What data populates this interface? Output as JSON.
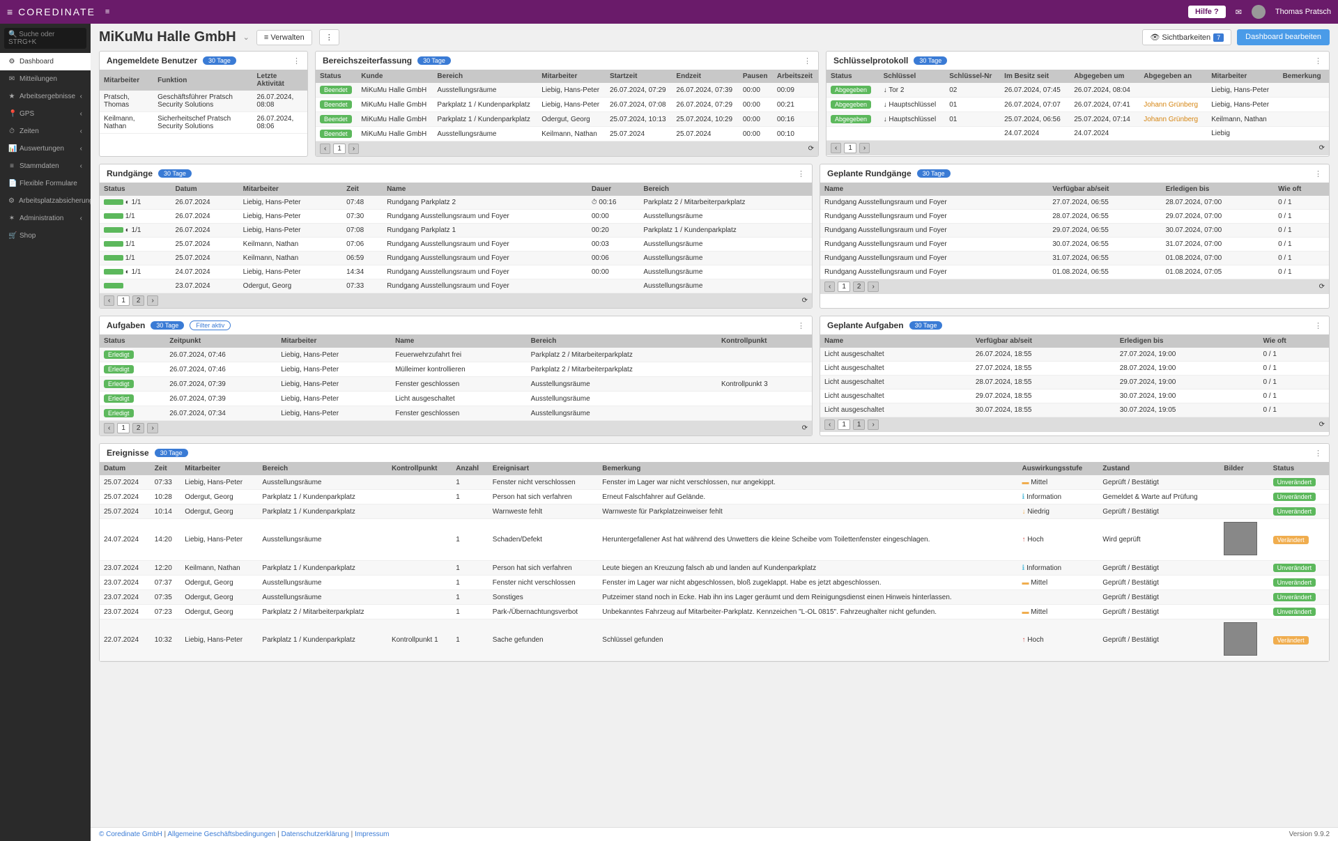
{
  "app": {
    "logo": "COREDINATE",
    "hilfe": "Hilfe",
    "user": "Thomas Pratsch"
  },
  "search": {
    "placeholder": "Suche oder STRG+K"
  },
  "nav": [
    {
      "icon": "⚙",
      "label": "Dashboard",
      "active": true
    },
    {
      "icon": "✉",
      "label": "Mitteilungen"
    },
    {
      "icon": "★",
      "label": "Arbeitsergebnisse",
      "chev": true
    },
    {
      "icon": "📍",
      "label": "GPS",
      "chev": true
    },
    {
      "icon": "⏱",
      "label": "Zeiten",
      "chev": true
    },
    {
      "icon": "📊",
      "label": "Auswertungen",
      "chev": true
    },
    {
      "icon": "≡",
      "label": "Stammdaten",
      "chev": true
    },
    {
      "icon": "📄",
      "label": "Flexible Formulare"
    },
    {
      "icon": "⚙",
      "label": "Arbeitsplatzabsicherung",
      "chev": true
    },
    {
      "icon": "✶",
      "label": "Administration",
      "chev": true
    },
    {
      "icon": "🛒",
      "label": "Shop"
    }
  ],
  "page": {
    "title": "MiKuMu Halle GmbH",
    "verwalten": "Verwalten",
    "sichtbarkeiten": "Sichtbarkeiten",
    "sb_count": "7",
    "dashboard_btn": "Dashboard bearbeiten"
  },
  "panels": {
    "benutzer": {
      "title": "Angemeldete Benutzer",
      "tag": "30 Tage",
      "cols": [
        "Mitarbeiter",
        "Funktion",
        "Letzte Aktivität"
      ],
      "rows": [
        [
          "Pratsch, Thomas",
          "Geschäftsführer Pratsch Security Solutions",
          "26.07.2024, 08:08"
        ],
        [
          "Keilmann, Nathan",
          "Sicherheitschef Pratsch Security Solutions",
          "26.07.2024, 08:06"
        ]
      ]
    },
    "bereich": {
      "title": "Bereichszeiterfassung",
      "tag": "30 Tage",
      "cols": [
        "Status",
        "Kunde",
        "Bereich",
        "Mitarbeiter",
        "Startzeit",
        "Endzeit",
        "Pausen",
        "Arbeitszeit"
      ],
      "rows": [
        [
          "Beendet",
          "MiKuMu Halle GmbH",
          "Ausstellungsräume",
          "Liebig, Hans-Peter",
          "26.07.2024, 07:29",
          "26.07.2024, 07:39",
          "00:00",
          "00:09"
        ],
        [
          "Beendet",
          "MiKuMu Halle GmbH",
          "Parkplatz 1 / Kundenparkplatz",
          "Liebig, Hans-Peter",
          "26.07.2024, 07:08",
          "26.07.2024, 07:29",
          "00:00",
          "00:21"
        ],
        [
          "Beendet",
          "MiKuMu Halle GmbH",
          "Parkplatz 1 / Kundenparkplatz",
          "Odergut, Georg",
          "25.07.2024, 10:13",
          "25.07.2024, 10:29",
          "00:00",
          "00:16"
        ],
        [
          "Beendet",
          "MiKuMu Halle GmbH",
          "Ausstellungsräume",
          "Keilmann, Nathan",
          "25.07.2024",
          "25.07.2024",
          "00:00",
          "00:10"
        ]
      ]
    },
    "schluessel": {
      "title": "Schlüsselprotokoll",
      "tag": "30 Tage",
      "cols": [
        "Status",
        "Schlüssel",
        "Schlüssel-Nr",
        "Im Besitz seit",
        "Abgegeben um",
        "Abgegeben an",
        "Mitarbeiter",
        "Bemerkung"
      ],
      "rows": [
        [
          "Abgegeben",
          "↓ Tor 2",
          "02",
          "26.07.2024, 07:45",
          "26.07.2024, 08:04",
          "",
          "Liebig, Hans-Peter",
          ""
        ],
        [
          "Abgegeben",
          "↓ Hauptschlüssel",
          "01",
          "26.07.2024, 07:07",
          "26.07.2024, 07:41",
          "Johann Grünberg",
          "Liebig, Hans-Peter",
          ""
        ],
        [
          "Abgegeben",
          "↓ Hauptschlüssel",
          "01",
          "25.07.2024, 06:56",
          "25.07.2024, 07:14",
          "Johann Grünberg",
          "Keilmann, Nathan",
          ""
        ],
        [
          "",
          "",
          "",
          "24.07.2024",
          "24.07.2024",
          "",
          "Liebig",
          ""
        ]
      ]
    },
    "rundgaenge": {
      "title": "Rundgänge",
      "tag": "30 Tage",
      "cols": [
        "Status",
        "Datum",
        "Mitarbeiter",
        "Zeit",
        "Name",
        "Dauer",
        "Bereich"
      ],
      "rows": [
        [
          "◐ 1/1",
          "26.07.2024",
          "Liebig, Hans-Peter",
          "07:48",
          "Rundgang Parkplatz 2",
          "⏱ 00:16",
          "Parkplatz 2 / Mitarbeiterparkplatz"
        ],
        [
          "1/1",
          "26.07.2024",
          "Liebig, Hans-Peter",
          "07:30",
          "Rundgang Ausstellungsraum und Foyer",
          "00:00",
          "Ausstellungsräume"
        ],
        [
          "◐ 1/1",
          "26.07.2024",
          "Liebig, Hans-Peter",
          "07:08",
          "Rundgang Parkplatz 1",
          "00:20",
          "Parkplatz 1 / Kundenparkplatz"
        ],
        [
          "1/1",
          "25.07.2024",
          "Keilmann, Nathan",
          "07:06",
          "Rundgang Ausstellungsraum und Foyer",
          "00:03",
          "Ausstellungsräume"
        ],
        [
          "1/1",
          "25.07.2024",
          "Keilmann, Nathan",
          "06:59",
          "Rundgang Ausstellungsraum und Foyer",
          "00:06",
          "Ausstellungsräume"
        ],
        [
          "◐ 1/1",
          "24.07.2024",
          "Liebig, Hans-Peter",
          "14:34",
          "Rundgang Ausstellungsraum und Foyer",
          "00:00",
          "Ausstellungsräume"
        ],
        [
          "",
          "23.07.2024",
          "Odergut, Georg",
          "07:33",
          "Rundgang Ausstellungsraum und Foyer",
          "",
          "Ausstellungsräume"
        ]
      ]
    },
    "gepl_rundgaenge": {
      "title": "Geplante Rundgänge",
      "tag": "30 Tage",
      "cols": [
        "Name",
        "Verfügbar ab/seit",
        "Erledigen bis",
        "Wie oft"
      ],
      "rows": [
        [
          "Rundgang Ausstellungsraum und Foyer",
          "27.07.2024, 06:55",
          "28.07.2024, 07:00",
          "0 / 1"
        ],
        [
          "Rundgang Ausstellungsraum und Foyer",
          "28.07.2024, 06:55",
          "29.07.2024, 07:00",
          "0 / 1"
        ],
        [
          "Rundgang Ausstellungsraum und Foyer",
          "29.07.2024, 06:55",
          "30.07.2024, 07:00",
          "0 / 1"
        ],
        [
          "Rundgang Ausstellungsraum und Foyer",
          "30.07.2024, 06:55",
          "31.07.2024, 07:00",
          "0 / 1"
        ],
        [
          "Rundgang Ausstellungsraum und Foyer",
          "31.07.2024, 06:55",
          "01.08.2024, 07:00",
          "0 / 1"
        ],
        [
          "Rundgang Ausstellungsraum und Foyer",
          "01.08.2024, 06:55",
          "01.08.2024, 07:05",
          "0 / 1"
        ]
      ]
    },
    "aufgaben": {
      "title": "Aufgaben",
      "tag": "30 Tage",
      "filter": "Filter aktiv",
      "cols": [
        "Status",
        "Zeitpunkt",
        "Mitarbeiter",
        "Name",
        "Bereich",
        "Kontrollpunkt"
      ],
      "rows": [
        [
          "Erledigt",
          "26.07.2024, 07:46",
          "Liebig, Hans-Peter",
          "Feuerwehrzufahrt frei",
          "Parkplatz 2 / Mitarbeiterparkplatz",
          ""
        ],
        [
          "Erledigt",
          "26.07.2024, 07:46",
          "Liebig, Hans-Peter",
          "Mülleimer kontrollieren",
          "Parkplatz 2 / Mitarbeiterparkplatz",
          ""
        ],
        [
          "Erledigt",
          "26.07.2024, 07:39",
          "Liebig, Hans-Peter",
          "Fenster geschlossen",
          "Ausstellungsräume",
          "Kontrollpunkt 3"
        ],
        [
          "Erledigt",
          "26.07.2024, 07:39",
          "Liebig, Hans-Peter",
          "Licht ausgeschaltet",
          "Ausstellungsräume",
          ""
        ],
        [
          "Erledigt",
          "26.07.2024, 07:34",
          "Liebig, Hans-Peter",
          "Fenster geschlossen",
          "Ausstellungsräume",
          ""
        ]
      ]
    },
    "gepl_aufgaben": {
      "title": "Geplante Aufgaben",
      "tag": "30 Tage",
      "cols": [
        "Name",
        "Verfügbar ab/seit",
        "Erledigen bis",
        "Wie oft"
      ],
      "rows": [
        [
          "Licht ausgeschaltet",
          "26.07.2024, 18:55",
          "27.07.2024, 19:00",
          "0 / 1"
        ],
        [
          "Licht ausgeschaltet",
          "27.07.2024, 18:55",
          "28.07.2024, 19:00",
          "0 / 1"
        ],
        [
          "Licht ausgeschaltet",
          "28.07.2024, 18:55",
          "29.07.2024, 19:00",
          "0 / 1"
        ],
        [
          "Licht ausgeschaltet",
          "29.07.2024, 18:55",
          "30.07.2024, 19:00",
          "0 / 1"
        ],
        [
          "Licht ausgeschaltet",
          "30.07.2024, 18:55",
          "30.07.2024, 19:05",
          "0 / 1"
        ]
      ]
    },
    "ereignisse": {
      "title": "Ereignisse",
      "tag": "30 Tage",
      "cols": [
        "Datum",
        "Zeit",
        "Mitarbeiter",
        "Bereich",
        "Kontrollpunkt",
        "Anzahl",
        "Ereignisart",
        "Bemerkung",
        "Auswirkungsstufe",
        "Zustand",
        "Bilder",
        "Status"
      ],
      "rows": [
        [
          "25.07.2024",
          "07:33",
          "Liebig, Hans-Peter",
          "Ausstellungsräume",
          "",
          "1",
          "Fenster nicht verschlossen",
          "Fenster im Lager war nicht verschlossen, nur angekippt.",
          "Mittel",
          "Geprüft / Bestätigt",
          "",
          "Unverändert"
        ],
        [
          "25.07.2024",
          "10:28",
          "Odergut, Georg",
          "Parkplatz 1 / Kundenparkplatz",
          "",
          "1",
          "Person hat sich verfahren",
          "Erneut Falschfahrer auf Gelände.",
          "Information",
          "Gemeldet & Warte auf Prüfung",
          "",
          "Unverändert"
        ],
        [
          "25.07.2024",
          "10:14",
          "Odergut, Georg",
          "Parkplatz 1 / Kundenparkplatz",
          "",
          "",
          "Warnweste fehlt",
          "Warnweste für Parkplatzeinweiser fehlt",
          "Niedrig",
          "Geprüft / Bestätigt",
          "",
          "Unverändert"
        ],
        [
          "24.07.2024",
          "14:20",
          "Liebig, Hans-Peter",
          "Ausstellungsräume",
          "",
          "1",
          "Schaden/Defekt",
          "Heruntergefallener Ast hat während des Unwetters die kleine Scheibe vom Toilettenfenster eingeschlagen.",
          "Hoch",
          "Wird geprüft",
          "img",
          "Verändert"
        ],
        [
          "23.07.2024",
          "12:20",
          "Keilmann, Nathan",
          "Parkplatz 1 / Kundenparkplatz",
          "",
          "1",
          "Person hat sich verfahren",
          "Leute biegen an Kreuzung falsch ab und landen auf Kundenparkplatz",
          "Information",
          "Geprüft / Bestätigt",
          "",
          "Unverändert"
        ],
        [
          "23.07.2024",
          "07:37",
          "Odergut, Georg",
          "Ausstellungsräume",
          "",
          "1",
          "Fenster nicht verschlossen",
          "Fenster im Lager war nicht abgeschlossen, bloß zugeklappt. Habe es jetzt abgeschlossen.",
          "Mittel",
          "Geprüft / Bestätigt",
          "",
          "Unverändert"
        ],
        [
          "23.07.2024",
          "07:35",
          "Odergut, Georg",
          "Ausstellungsräume",
          "",
          "1",
          "Sonstiges",
          "Putzeimer stand noch in Ecke. Hab ihn ins Lager geräumt und dem Reinigungsdienst einen Hinweis hinterlassen.",
          "",
          "Geprüft / Bestätigt",
          "",
          "Unverändert"
        ],
        [
          "23.07.2024",
          "07:23",
          "Odergut, Georg",
          "Parkplatz 2 / Mitarbeiterparkplatz",
          "",
          "1",
          "Park-/Übernachtungsverbot",
          "Unbekanntes Fahrzeug auf Mitarbeiter-Parkplatz. Kennzeichen \"L-OL 0815\". Fahrzeughalter nicht gefunden.",
          "Mittel",
          "Geprüft / Bestätigt",
          "",
          "Unverändert"
        ],
        [
          "22.07.2024",
          "10:32",
          "Liebig, Hans-Peter",
          "Parkplatz 1 / Kundenparkplatz",
          "Kontrollpunkt 1",
          "1",
          "Sache gefunden",
          "Schlüssel gefunden",
          "Hoch",
          "Geprüft / Bestätigt",
          "img",
          "Verändert"
        ]
      ]
    }
  },
  "footer": {
    "company": "© Coredinate GmbH",
    "links": [
      "Allgemeine Geschäftsbedingungen",
      "Datenschutzerklärung",
      "Impressum"
    ],
    "version": "Version 9.9.2"
  }
}
